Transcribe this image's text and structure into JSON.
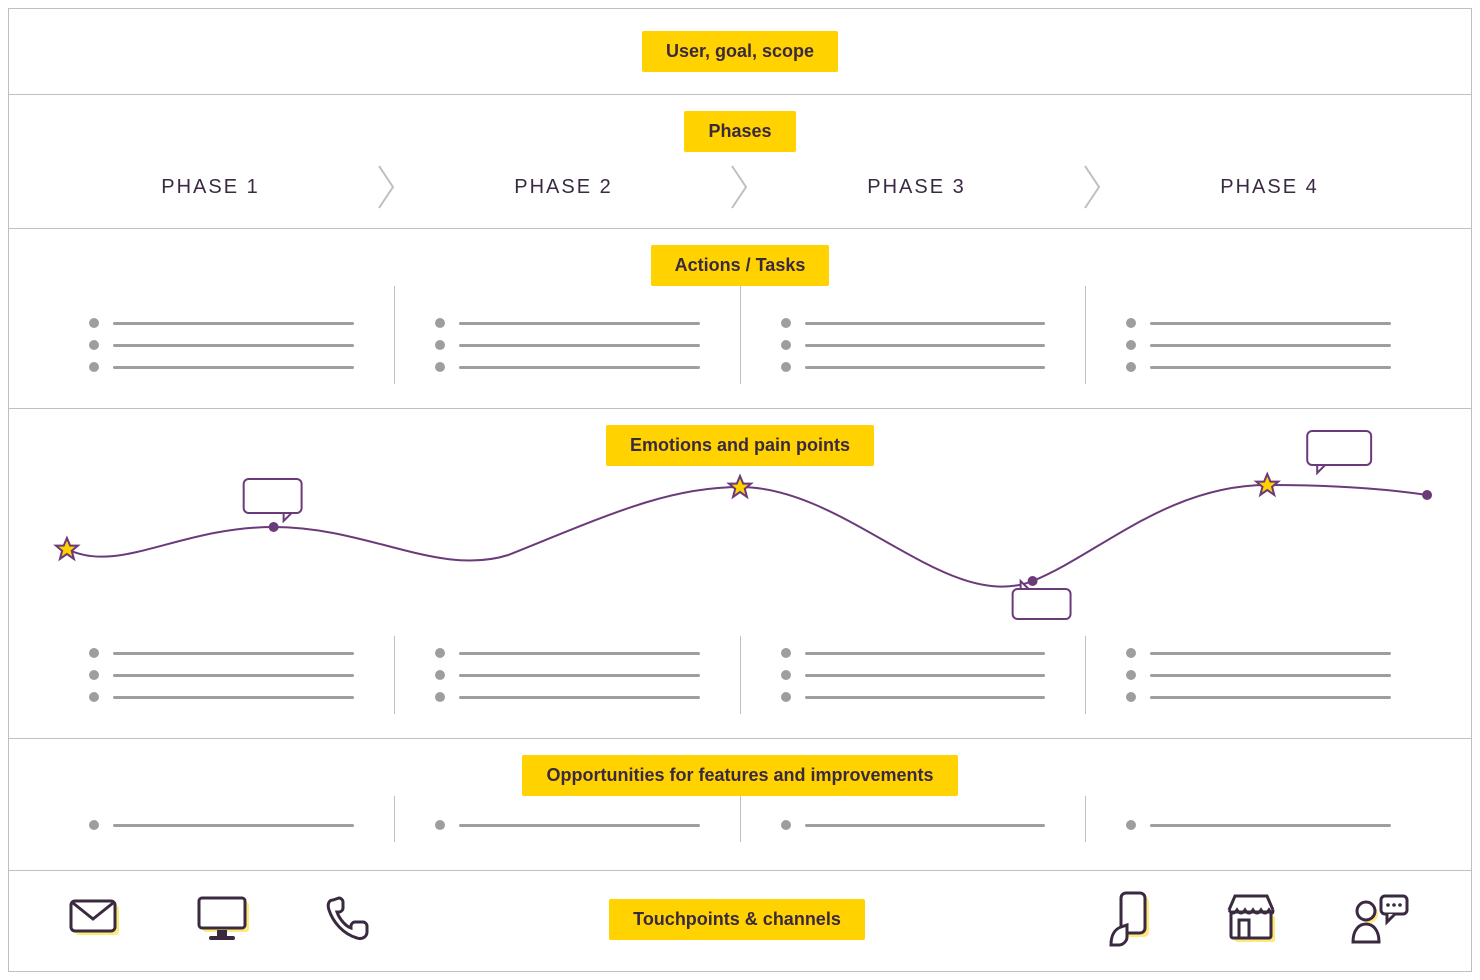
{
  "colors": {
    "accent_yellow": "#ffd200",
    "text_dark": "#3a2a3f",
    "line_purple": "#6b3a7a",
    "grey": "#9e9e9e"
  },
  "labels": {
    "user_goal_scope": "User, goal, scope",
    "phases": "Phases",
    "actions_tasks": "Actions / Tasks",
    "emotions": "Emotions and pain points",
    "opportunities": "Opportunities for features and improvements",
    "touchpoints": "Touchpoints & channels"
  },
  "phases": [
    "PHASE 1",
    "PHASE 2",
    "PHASE 3",
    "PHASE 4"
  ],
  "touchpoint_icons": [
    "mail",
    "desktop",
    "phone-handset",
    "smartphone-hand",
    "storefront",
    "person-chat"
  ],
  "chart_data": {
    "type": "line",
    "title": "Emotions and pain points",
    "xlabel": "",
    "ylabel": "",
    "ylim": [
      0,
      100
    ],
    "x_positions_pct": [
      4,
      18,
      34,
      50,
      70,
      86,
      97
    ],
    "values": [
      48,
      60,
      45,
      82,
      30,
      83,
      78
    ],
    "markers": [
      {
        "x_pct": 4,
        "y": 48,
        "type": "star"
      },
      {
        "x_pct": 18,
        "y": 60,
        "type": "dot-speech-top"
      },
      {
        "x_pct": 50,
        "y": 82,
        "type": "star"
      },
      {
        "x_pct": 70,
        "y": 30,
        "type": "dot-speech-bottom"
      },
      {
        "x_pct": 86,
        "y": 83,
        "type": "star-speech-top"
      },
      {
        "x_pct": 97,
        "y": 78,
        "type": "dot"
      }
    ]
  }
}
